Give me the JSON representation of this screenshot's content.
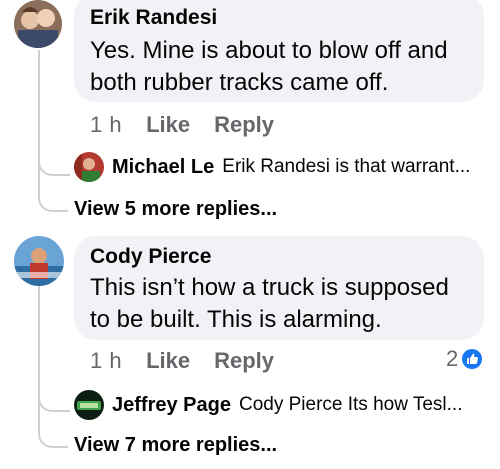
{
  "comments": [
    {
      "author": "Erik Randesi",
      "line1": "Yes. Mine is about to blow off and",
      "line2": "both rubber tracks came off.",
      "time": "1 h",
      "like": "Like",
      "reply": "Reply",
      "reply_preview": {
        "name": "Michael Le",
        "text": "Erik Randesi is that warrant..."
      },
      "more_replies": "View 5 more replies..."
    },
    {
      "author": "Cody Pierce",
      "line1": "This isn’t how a truck is supposed",
      "line2": "to be built. This is alarming.",
      "time": "1 h",
      "like": "Like",
      "reply": "Reply",
      "reaction_count": "2",
      "reply_preview": {
        "name": "Jeffrey Page",
        "text": "Cody Pierce Its how Tesl..."
      },
      "more_replies": "View 7 more replies..."
    }
  ],
  "colors": {
    "bubble": "#f0f2f5",
    "thread_line": "#ced0d4",
    "meta_text": "#65676b",
    "like_blue": "#1877f2"
  }
}
